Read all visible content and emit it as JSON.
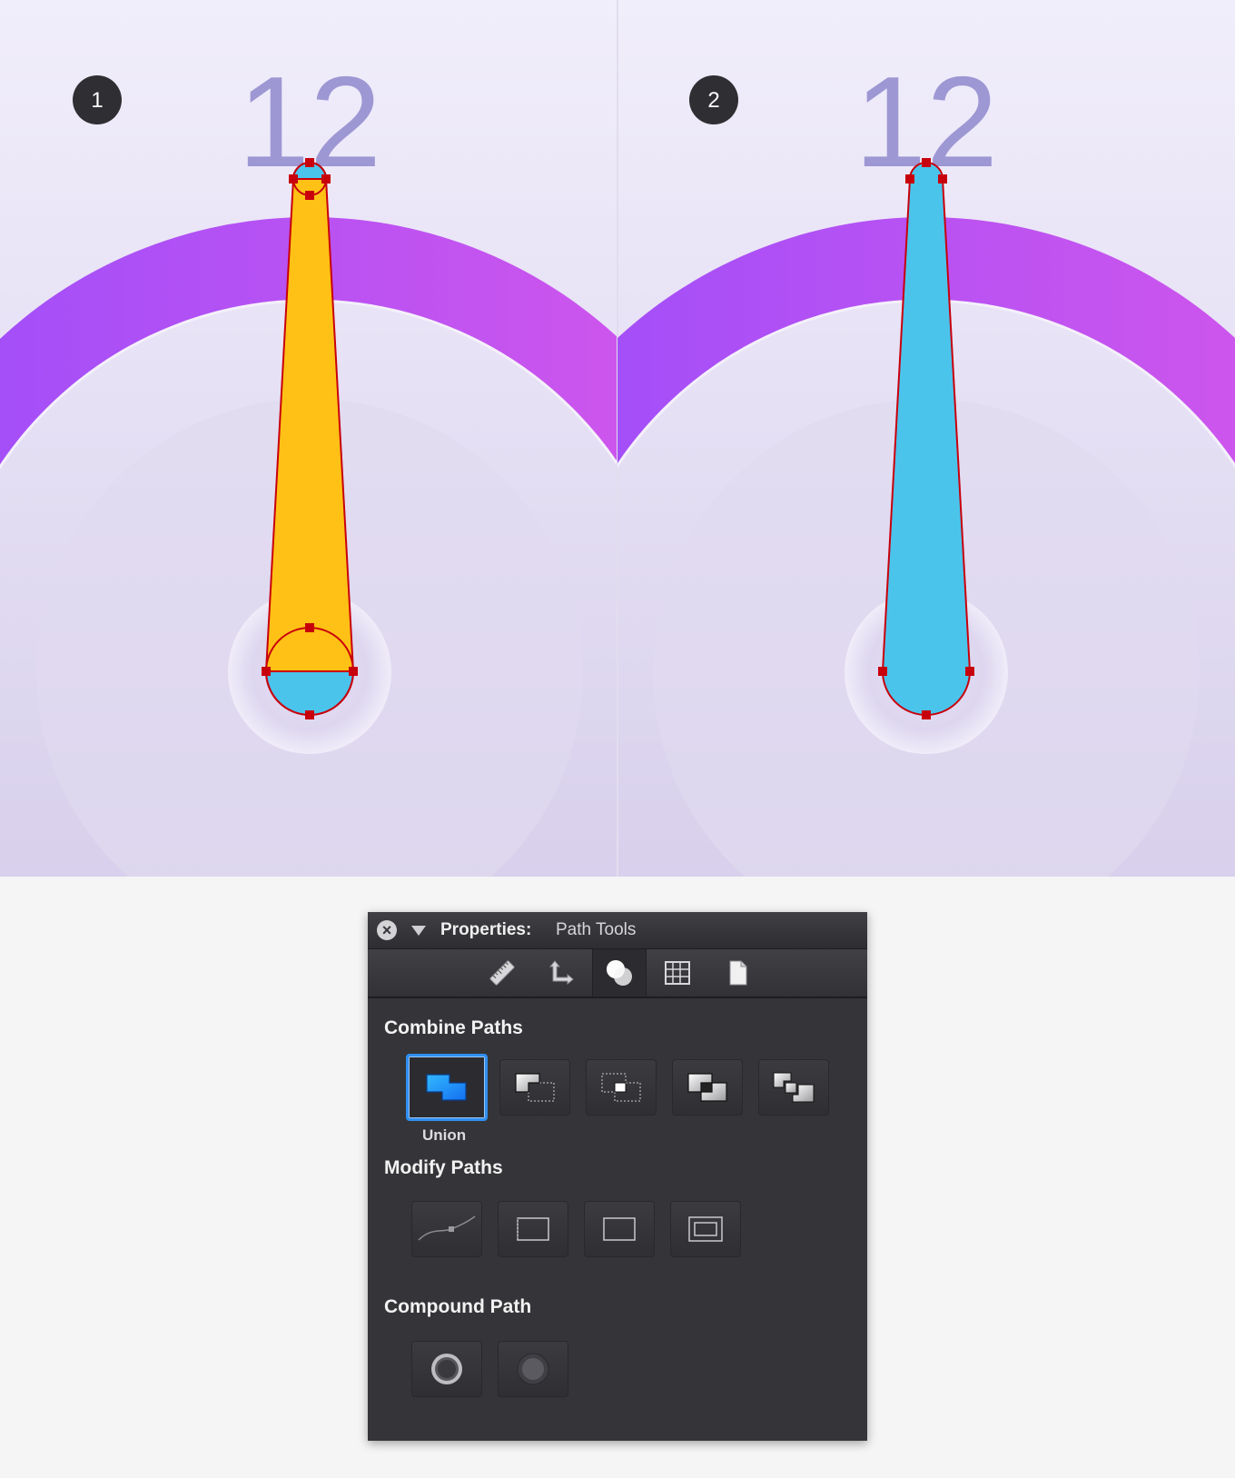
{
  "steps": [
    {
      "badge": "1",
      "number": "12"
    },
    {
      "badge": "2",
      "number": "12"
    }
  ],
  "colors": {
    "arc_start": "#9b4dfb",
    "arc_end": "#d657ea",
    "hand_yellow": "#ffc115",
    "hand_blue": "#4bc4ec",
    "anchor": "#c8000c",
    "number": "#9d97d3",
    "background_top": "#f1eefb",
    "background_bottom": "#d8d0ec",
    "selected_outline": "#2f8ff0"
  },
  "panel": {
    "title": "Properties:",
    "subtitle": "Path Tools",
    "tabs": [
      {
        "icon": "ruler-icon"
      },
      {
        "icon": "move-icon"
      },
      {
        "icon": "path-ops-icon"
      },
      {
        "icon": "grid-icon"
      },
      {
        "icon": "document-icon"
      }
    ],
    "combine_heading": "Combine Paths",
    "combine_buttons": [
      {
        "icon": "union-icon",
        "caption": "Union"
      },
      {
        "icon": "subtract-icon"
      },
      {
        "icon": "intersect-icon"
      },
      {
        "icon": "exclude-icon"
      },
      {
        "icon": "divide-icon"
      }
    ],
    "modify_heading": "Modify Paths",
    "modify_buttons": [
      {
        "icon": "smooth-path-icon"
      },
      {
        "icon": "dashed-rect-icon"
      },
      {
        "icon": "rect-icon"
      },
      {
        "icon": "inset-rect-icon"
      }
    ],
    "compound_heading": "Compound Path",
    "compound_buttons": [
      {
        "icon": "make-compound-icon"
      },
      {
        "icon": "release-compound-icon"
      }
    ]
  }
}
